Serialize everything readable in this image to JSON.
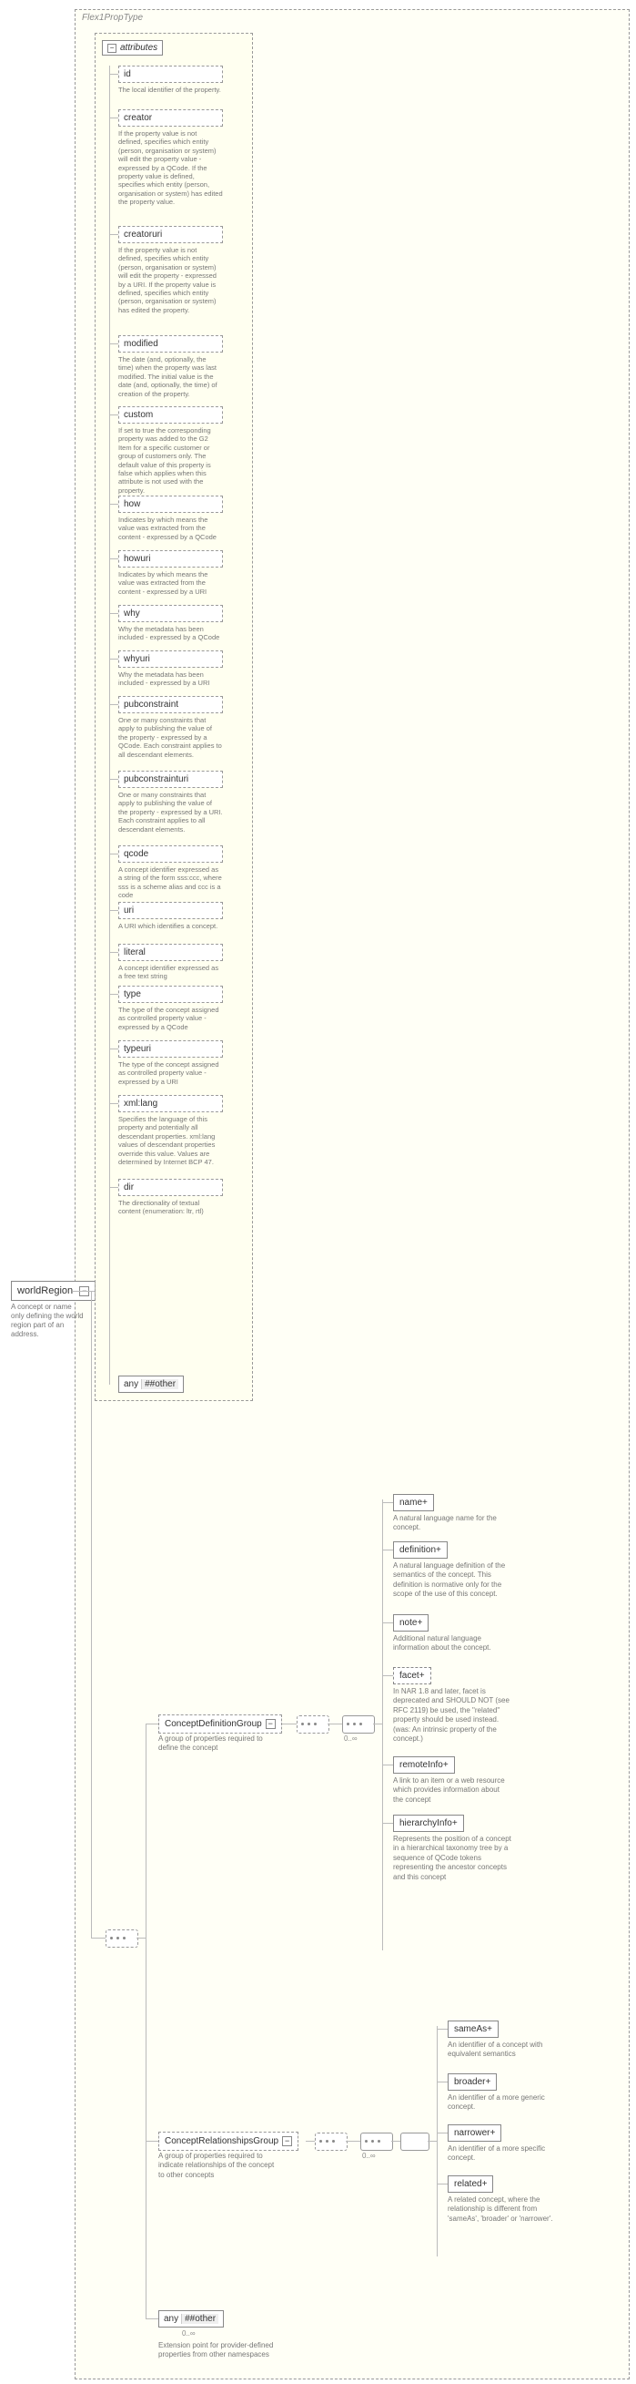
{
  "root": {
    "name": "worldRegion",
    "desc": "A concept or name only defining the world region part of an address."
  },
  "typeBox": {
    "label": "Flex1PropType",
    "attrHeader": "attributes"
  },
  "attrs": [
    {
      "name": "id",
      "desc": "The local identifier of the property."
    },
    {
      "name": "creator",
      "desc": "If the property value is not defined, specifies which entity (person, organisation or system) will edit the property value - expressed by a QCode. If the property value is defined, specifies which entity (person, organisation or system) has edited the property value."
    },
    {
      "name": "creatoruri",
      "desc": "If the property value is not defined, specifies which entity (person, organisation or system) will edit the property - expressed by a URI. If the property value is defined, specifies which entity (person, organisation or system) has edited the property."
    },
    {
      "name": "modified",
      "desc": "The date (and, optionally, the time) when the property was last modified. The initial value is the date (and, optionally, the time) of creation of the property."
    },
    {
      "name": "custom",
      "desc": "If set to true the corresponding property was added to the G2 Item for a specific customer or group of customers only. The default value of this property is false which applies when this attribute is not used with the property."
    },
    {
      "name": "how",
      "desc": "Indicates by which means the value was extracted from the content - expressed by a QCode"
    },
    {
      "name": "howuri",
      "desc": "Indicates by which means the value was extracted from the content - expressed by a URI"
    },
    {
      "name": "why",
      "desc": "Why the metadata has been included - expressed by a QCode"
    },
    {
      "name": "whyuri",
      "desc": "Why the metadata has been included - expressed by a URI"
    },
    {
      "name": "pubconstraint",
      "desc": "One or many constraints that apply to publishing the value of the property - expressed by a QCode. Each constraint applies to all descendant elements."
    },
    {
      "name": "pubconstrainturi",
      "desc": "One or many constraints that apply to publishing the value of the property - expressed by a URI. Each constraint applies to all descendant elements."
    },
    {
      "name": "qcode",
      "desc": "A concept identifier expressed as a string of the form sss:ccc, where sss is a scheme alias and ccc is a code"
    },
    {
      "name": "uri",
      "desc": "A URI which identifies a concept."
    },
    {
      "name": "literal",
      "desc": "A concept identifier expressed as a free text string"
    },
    {
      "name": "type",
      "desc": "The type of the concept assigned as controlled property value - expressed by a QCode"
    },
    {
      "name": "typeuri",
      "desc": "The type of the concept assigned as controlled property value - expressed by a URI"
    },
    {
      "name": "xml:lang",
      "desc": "Specifies the language of this property and potentially all descendant properties. xml:lang values of descendant properties override this value. Values are determined by Internet BCP 47."
    },
    {
      "name": "dir",
      "desc": "The directionality of textual content (enumeration: ltr, rtl)"
    }
  ],
  "anyOther": "##other",
  "anyLabel": "any",
  "groups": {
    "cdg": {
      "name": "ConceptDefinitionGroup",
      "desc": "A group of properties required to define the concept"
    },
    "crg": {
      "name": "ConceptRelationshipsGroup",
      "desc": "A group of properties required to indicate relationships of the concept to other concepts"
    }
  },
  "cdgEls": [
    {
      "name": "name",
      "desc": "A natural language name for the concept."
    },
    {
      "name": "definition",
      "desc": "A natural language definition of the semantics of the concept. This definition is normative only for the scope of the use of this concept."
    },
    {
      "name": "note",
      "desc": "Additional natural language information about the concept."
    },
    {
      "name": "facet",
      "desc": "In NAR 1.8 and later, facet is deprecated and SHOULD NOT (see RFC 2119) be used, the \"related\" property should be used instead.(was: An intrinsic property of the concept.)"
    },
    {
      "name": "remoteInfo",
      "desc": "A link to an item or a web resource which provides information about the concept"
    },
    {
      "name": "hierarchyInfo",
      "desc": "Represents the position of a concept in a hierarchical taxonomy tree by a sequence of QCode tokens representing the ancestor concepts and this concept"
    }
  ],
  "crgEls": [
    {
      "name": "sameAs",
      "desc": "An identifier of a concept with equivalent semantics"
    },
    {
      "name": "broader",
      "desc": "An identifier of a more generic concept."
    },
    {
      "name": "narrower",
      "desc": "An identifier of a more specific concept."
    },
    {
      "name": "related",
      "desc": "A related concept, where the relationship is different from 'sameAs', 'broader' or 'narrower'."
    }
  ],
  "extAny": {
    "label": "any",
    "ns": "##other",
    "card": "0..∞",
    "desc": "Extension point for provider-defined properties from other namespaces"
  },
  "cards": {
    "zeroInf": "0..∞"
  }
}
